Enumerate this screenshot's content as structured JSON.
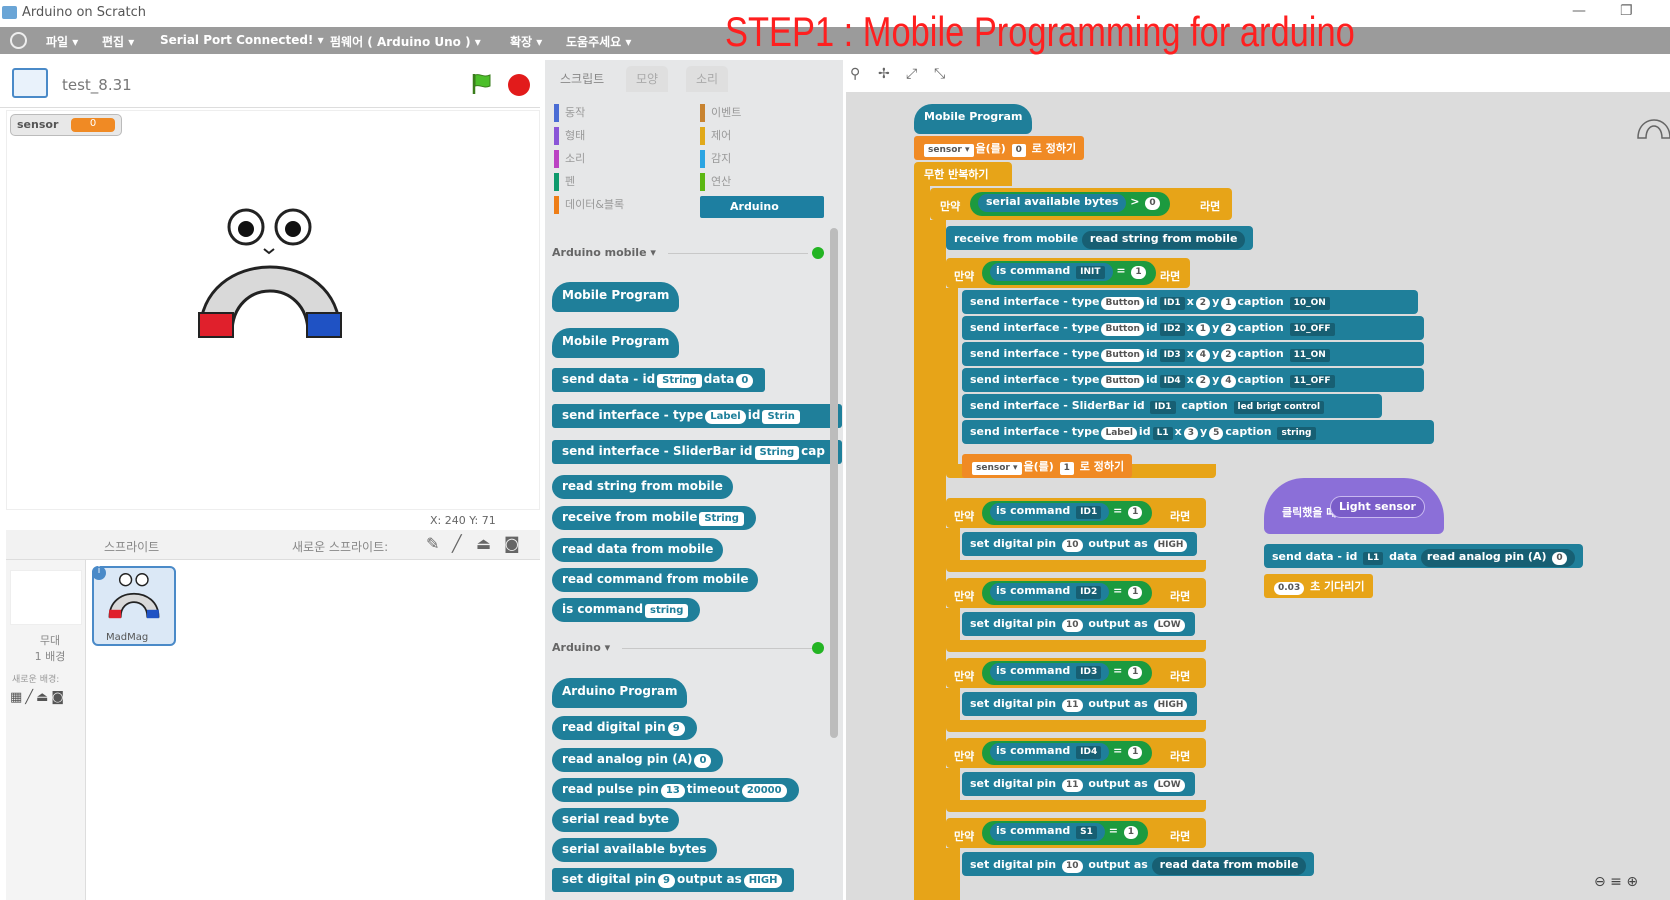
{
  "window": {
    "title": "Arduino on Scratch"
  },
  "menu": [
    "파일 ▾",
    "편집 ▾",
    "Serial Port Connected! ▾",
    "펌웨어 ( Arduino Uno ) ▾",
    "확장 ▾",
    "도움주세요 ▾"
  ],
  "overlay": {
    "step_title": "STEP1 : Mobile Programming for arduino"
  },
  "stage": {
    "project_name": "test_8.31",
    "monitor_label": "sensor",
    "monitor_value": "0",
    "coords": "X: 240  Y: 71"
  },
  "sprites": {
    "header_label": "스프라이트",
    "new_sprite_label": "새로운 스프라이트:",
    "stage_label_1": "무대",
    "stage_label_2": "1 배경",
    "new_backdrop": "새로운 배경:",
    "sprite_name": "MadMag"
  },
  "palette": {
    "tabs": [
      "스크립트",
      "모양",
      "소리"
    ],
    "categories_left": [
      {
        "label": "동작",
        "color": "#4a6cd4"
      },
      {
        "label": "형태",
        "color": "#8a55d7"
      },
      {
        "label": "소리",
        "color": "#bb42c3"
      },
      {
        "label": "펜",
        "color": "#0e9a6c"
      },
      {
        "label": "데이터&블록",
        "color": "#ee7d16"
      }
    ],
    "categories_right": [
      {
        "label": "이벤트",
        "color": "#c88330"
      },
      {
        "label": "제어",
        "color": "#e1a91a"
      },
      {
        "label": "감지",
        "color": "#2ca5e2"
      },
      {
        "label": "연산",
        "color": "#5cb712"
      }
    ],
    "selected_category": "Arduino",
    "section1": "Arduino mobile ▾",
    "section2": "Arduino ▾",
    "mobile_blocks": {
      "hat1": "Mobile Program",
      "hat2": "Mobile Program",
      "send_data": "send data - id",
      "send_data_id": "String",
      "send_data_mid": "data",
      "send_data_val": "0",
      "send_iface": "send interface - type",
      "send_iface_type": "Label",
      "send_iface_id": "id",
      "send_iface_idv": "Strin",
      "send_slider": "send interface - SliderBar id",
      "send_slider_v": "String",
      "send_slider_cap": "cap",
      "read_string": "read string from mobile",
      "receive": "receive from mobile",
      "receive_v": "String",
      "read_data": "read data from mobile",
      "read_cmd": "read command from mobile",
      "is_cmd": "is command",
      "is_cmd_v": "string"
    },
    "arduino_blocks": {
      "hat": "Arduino Program",
      "read_digital": "read digital pin",
      "read_digital_v": "9",
      "read_analog": "read analog pin (A)",
      "read_analog_v": "0",
      "read_pulse": "read pulse pin",
      "read_pulse_v": "13",
      "read_pulse_t": "timeout",
      "read_pulse_tv": "20000",
      "serial_read": "serial read byte",
      "serial_avail": "serial available bytes",
      "set_digital": "set digital pin",
      "set_digital_v": "9",
      "set_digital_o": "output as",
      "set_digital_ov": "HIGH"
    }
  },
  "script": {
    "hat": "Mobile Program",
    "set_var_a": "sensor ▾",
    "set_var_b": "을(를)",
    "set_var_c": "0",
    "set_var_d": "로 정하기",
    "forever": "무한 반복하기",
    "if": "만약",
    "then": "라면",
    "serial_avail": "serial available bytes",
    "gt": ">",
    "zero": "0",
    "receive": "receive from mobile",
    "read_string": "read string from mobile",
    "is_cmd": "is command",
    "eq": "=",
    "one": "1",
    "cmd_init": "INIT",
    "iface_rows": [
      {
        "type": "Button",
        "id": "ID1",
        "x": "2",
        "y": "1",
        "cap": "10_ON"
      },
      {
        "type": "Button",
        "id": "ID2",
        "x": "1",
        "y": "2",
        "cap": "10_OFF"
      },
      {
        "type": "Button",
        "id": "ID3",
        "x": "4",
        "y": "2",
        "cap": "11_ON"
      },
      {
        "type": "Button",
        "id": "ID4",
        "x": "2",
        "y": "4",
        "cap": "11_OFF"
      }
    ],
    "send_iface": "send interface - type",
    "id": "id",
    "xlab": "x",
    "ylab": "y",
    "caplab": "caption",
    "slider": "send interface - SliderBar id",
    "slider_id": "ID1",
    "slider_cap": "led brigt control",
    "label_row": {
      "type": "Label",
      "id": "L1",
      "x": "3",
      "y": "5",
      "cap": "string"
    },
    "set_sensor": "sensor ▾",
    "set_sensor_v": "1",
    "set_sensor_to": "로 정하기",
    "cmd_blocks": [
      {
        "cmd": "ID1",
        "pin": "10",
        "val": "HIGH"
      },
      {
        "cmd": "ID2",
        "pin": "10",
        "val": "LOW"
      },
      {
        "cmd": "ID3",
        "pin": "11",
        "val": "HIGH"
      },
      {
        "cmd": "ID4",
        "pin": "11",
        "val": "LOW"
      }
    ],
    "cmd_s1": "S1",
    "set_digital": "set digital pin",
    "output_as": "output as",
    "read_data": "read data from mobile",
    "side_hat": "클릭했을 때",
    "side_hat_v": "Light sensor",
    "side_send": "send data - id",
    "side_send_id": "L1",
    "side_send_data": "data",
    "side_send_read": "read analog pin (A)",
    "side_send_pin": "0",
    "wait_v": "0.03",
    "wait_l": "초 기다리기"
  }
}
